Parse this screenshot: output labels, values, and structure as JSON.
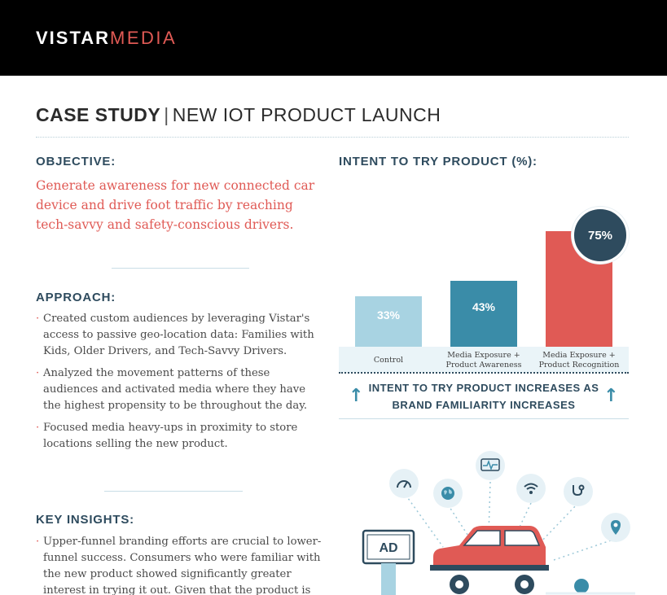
{
  "brand": {
    "logo_part1": "VISTAR",
    "logo_part2": "MEDIA"
  },
  "title": {
    "bold": "CASE STUDY",
    "separator": "|",
    "rest": "NEW IOT PRODUCT LAUNCH"
  },
  "objective": {
    "heading": "OBJECTIVE:",
    "text": "Generate awareness for new connected car device and drive foot traffic by reaching tech-savvy and safety-conscious drivers."
  },
  "approach": {
    "heading": "APPROACH:",
    "items": [
      "Created custom audiences by leveraging Vistar's access to passive geo-location data: Families with Kids, Older Drivers, and Tech-Savvy Drivers.",
      "Analyzed the movement patterns of these audiences and activated media where they have the highest propensity to be throughout the day.",
      "Focused media heavy-ups in proximity to store locations selling the new product."
    ]
  },
  "insights": {
    "heading": "KEY INSIGHTS:",
    "items": [
      "Upper-funnel branding efforts are crucial to lower-funnel success. Consumers who were familiar with the new product showed significantly greater interest in trying it out. Given that the product is new to the"
    ]
  },
  "chart_data": {
    "type": "bar",
    "title": "INTENT TO TRY PRODUCT (%):",
    "categories": [
      "Control",
      "Media Exposure + Product Awareness",
      "Media Exposure + Product Recognition"
    ],
    "category_lines": [
      [
        "Control"
      ],
      [
        "Media Exposure +",
        "Product Awareness"
      ],
      [
        "Media Exposure +",
        "Product Recognition"
      ]
    ],
    "values": [
      33,
      43,
      75
    ],
    "value_labels": [
      "33%",
      "43%",
      "75%"
    ],
    "colors": [
      "#a8d3e2",
      "#3a8ca8",
      "#e05a55"
    ],
    "highlight_color": "#2e4b5e",
    "ylim": [
      0,
      100
    ],
    "grid": false,
    "xlabel": "",
    "ylabel": ""
  },
  "callout": {
    "line1": "INTENT TO TRY PRODUCT INCREASES AS",
    "line2": "BRAND FAMILIARITY INCREASES",
    "arrow": "↑"
  },
  "illustration": {
    "billboard_text": "AD"
  },
  "colors": {
    "accent": "#e05a55",
    "navy": "#2e4b5e",
    "teal": "#3a8ca8",
    "light_blue": "#a8d3e2"
  }
}
